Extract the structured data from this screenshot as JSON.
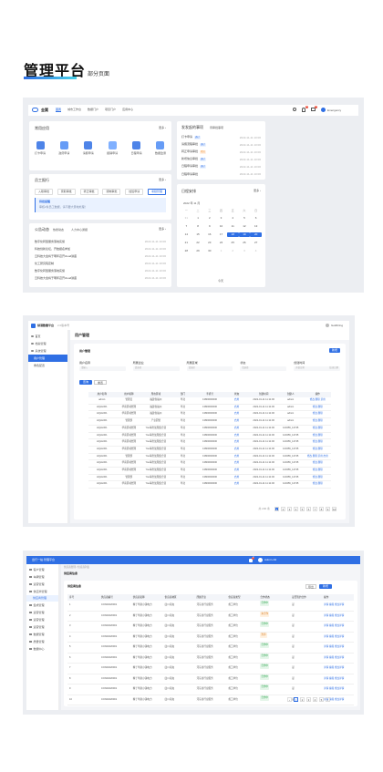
{
  "header": {
    "title": "管理平台",
    "subtitle": "部分页面"
  },
  "s1": {
    "logo": "金翼",
    "nav": [
      "首页",
      "城市工作台",
      "数据门户",
      "项目门户",
      "应用中心"
    ],
    "user": "Emergency",
    "badge1": "2",
    "badge2": "1",
    "common": {
      "title": "常用应用",
      "more": "更多 ›",
      "apps": [
        "打卡申请",
        "政府申请",
        "请假申请",
        "报销申请",
        "日程申请",
        "数据监测"
      ]
    },
    "todo": {
      "title": "员工报行",
      "more": "更多 ›",
      "tabs": [
        "入职审批",
        "离职审批",
        "转正审批",
        "调岗审批",
        "加班申请",
        "考勤管理"
      ],
      "banner_title": "待批提醒",
      "banner_text": "审核2条员工数据，请不要大意地处理！"
    },
    "notice": {
      "title": "公告动态",
      "tab2": "热搜动态",
      "tab3": "人力中心通报",
      "more": "更多 ›",
      "items": [
        {
          "t": "数字化转型服务落地实施",
          "d": "2022-11-11 10:00"
        },
        {
          "t": "科技创新论坛，开始报名参加",
          "d": "2022-11-11 10:00"
        },
        {
          "t": "云科技大会将于明年召开cloud讲座",
          "d": "2022-11-11 10:00"
        },
        {
          "t": "化工研究院定制",
          "d": "2022-11-11 10:00"
        },
        {
          "t": "数字化转型服务落地实施",
          "d": "2022-11-11 10:00"
        },
        {
          "t": "云科技大会将于明年召开cloud讲座",
          "d": "2022-11-11 10:00"
        }
      ]
    },
    "approval": {
      "title": "发发起的事项",
      "tab2": "待审批事项",
      "items": [
        {
          "t": "打卡申请",
          "tag": "通过",
          "d": "2022-11-11 10:00"
        },
        {
          "t": "请假流程审批",
          "tag": "通过",
          "d": "2022-11-11 10:00"
        },
        {
          "t": "转正申请审批",
          "tag": "驳回",
          "d": "2022-11-11 10:00"
        },
        {
          "t": "新增信息审批",
          "tag": "通过",
          "d": "2022-11-11 10:00"
        },
        {
          "t": "日程申请审批",
          "tag": "通过",
          "d": "2022-11-11 10:00"
        },
        {
          "t": "日程申请审批",
          "tag": "",
          "d": "2022-11-11 10:00"
        }
      ]
    },
    "calendar": {
      "title": "日程安排",
      "more": "更多 ›",
      "month": "2022 年 11 月",
      "week": [
        "一",
        "二",
        "三",
        "四",
        "五",
        "六",
        "日"
      ],
      "days": [
        31,
        1,
        2,
        3,
        4,
        5,
        6,
        7,
        8,
        9,
        10,
        11,
        12,
        13,
        14,
        15,
        16,
        17,
        18,
        19,
        20,
        21,
        22,
        23,
        24,
        25,
        26,
        27,
        28,
        29,
        30,
        1,
        2,
        3,
        4
      ],
      "highlight": [
        18,
        19,
        20
      ],
      "footer": "今天"
    }
  },
  "s2": {
    "logo": "绿港数管平台",
    "tag": "2.0版本号",
    "user": "Goldbring",
    "sidebar": [
      "首页",
      "档案管理",
      "系统管理",
      "用户管理",
      "角色配置"
    ],
    "page_title": "用户管理",
    "card_title": "用户管理",
    "new_btn": "新增",
    "filters": [
      {
        "l": "用户名称",
        "p": "请输入"
      },
      {
        "l": "所属企业",
        "p": "请选择"
      },
      {
        "l": "所属区域",
        "p": "请选择"
      },
      {
        "l": "状态",
        "p": "请选择"
      },
      {
        "l": "创建时间",
        "p": "开始日期"
      }
    ],
    "date_end": "结束日期",
    "search": "查询",
    "reset": "重置",
    "cols": [
      "用户名称",
      "用户昵称",
      "所在区域",
      "部门",
      "手机号",
      "状态",
      "创建时间",
      "创建人",
      "操作"
    ],
    "rows": [
      [
        "admin",
        "管理员",
        "福建省福州",
        "华北",
        "13800000000",
        "启用",
        "2022-01-11 11:11:00",
        "admin",
        "修改 删除 禁用"
      ],
      [
        "HQHL001",
        "华南区域经理",
        "福建省福州",
        "华北",
        "13800000000",
        "启用",
        "2022-01-11 11:11:00",
        "admin",
        "修改 删除"
      ],
      [
        "HQHL001",
        "华南区域经理",
        "福建省福州",
        "华北",
        "13800000000",
        "启用",
        "2022-01-11 11:11:00",
        "admin",
        "修改 删除"
      ],
      [
        "HQHL001",
        "管理部",
        "产业园管",
        "华北",
        "13800000000",
        "启用",
        "2022-01-11 11:11:00",
        "admin",
        "修改 删除"
      ],
      [
        "HQHL001",
        "华南区域经理",
        "Yoo事务处理组合营",
        "华北",
        "13800000000",
        "启用",
        "2022-01-11 11:11:00",
        "123456_12745",
        "修改 删除"
      ],
      [
        "HQHL001",
        "华南区域经理",
        "Yoo事务处理组合营",
        "华北",
        "13800000000",
        "启用",
        "2022-01-11 11:11:00",
        "123456_12745",
        "修改 删除"
      ],
      [
        "HQHL001",
        "华南区域经理",
        "Yoo事务处理组合营",
        "华北",
        "13800000000",
        "启用",
        "2022-01-11 11:11:00",
        "123456_12745",
        "修改 删除"
      ],
      [
        "HQHL001",
        "华南区域经理",
        "Yoo事务处理组合营",
        "华北",
        "13800000000",
        "启用",
        "2022-01-11 11:11:00",
        "123456_12745",
        "修改 删除"
      ],
      [
        "HQHL001",
        "管理部",
        "Yoo事务处理组合营",
        "华北",
        "13800000000",
        "启用",
        "2022-01-11 11:11:00",
        "123456_12745",
        "修改 删除 禁用 启用"
      ],
      [
        "HQHL001",
        "华南区域经理",
        "Yoo事务处理组合营",
        "华北",
        "13800000000",
        "启用",
        "2022-01-11 11:11:00",
        "123456_12745",
        "修改 删除"
      ],
      [
        "HQHL001",
        "华南区域经理",
        "Yoo事务处理组合营",
        "华北",
        "13800000000",
        "启用",
        "2022-01-11 11:11:00",
        "123456_12745",
        "修改 删除"
      ],
      [
        "HQHL001",
        "管理部",
        "Yoo事务处理组合营",
        "华北",
        "13800000000",
        "启用",
        "2022-01-11 11:11:00",
        "123456_12745",
        "修改 删除"
      ],
      [
        "HQHL001",
        "华南区域经理",
        "Yoo事务处理组合营",
        "华北",
        "13800000000",
        "启用",
        "2022-01-11 11:11:00",
        "123456_12745",
        "修改 删除"
      ]
    ],
    "pager": {
      "total": "共 200 条",
      "pages": [
        "1",
        "2",
        "3",
        "4",
        "5",
        "6",
        "7",
        "8",
        "9",
        "10"
      ]
    }
  },
  "s3": {
    "logo": "出行一站·管理平台",
    "user": "Admin·A6",
    "badge": "2",
    "sidebar": [
      "客户管理",
      "车辆管理",
      "运营管理",
      "供应商管理",
      "集成管理",
      "运营管理",
      "运营管理",
      "运营管理",
      "数据管理",
      "质量管理",
      "数据中心"
    ],
    "active": "供应商管理",
    "breadcrumb": "供应商管理 / 供应商列表",
    "page_title": "供应商信息",
    "card_title": "供应商信息",
    "export": "导出",
    "add": "新增",
    "cols": [
      "序号",
      "供应商编号",
      "供应商名称",
      "供应商地区",
      "所属行业",
      "供应商类型",
      "合作状态",
      "是否签约合作",
      "操作"
    ],
    "rows": [
      [
        "1",
        "CON20220001",
        "精于华航小镇电力",
        "四川南充",
        "河东省行业服务",
        "施工单位",
        "合作中",
        "是",
        "详情 编辑 修改详情"
      ],
      [
        "2",
        "CON20220001",
        "精于华航小镇电力",
        "四川南充",
        "河东省行业服务",
        "施工单位",
        "未合作",
        "是",
        "详情 编辑 修改详情"
      ],
      [
        "3",
        "CON20220001",
        "精于华航小镇电力",
        "四川南充",
        "河东省行业服务",
        "施工单位",
        "合作中",
        "是",
        "详情 编辑 修改详情"
      ],
      [
        "4",
        "CON20220001",
        "精于华航小镇电力",
        "四川南充",
        "河东省行业服务",
        "施工单位",
        "暂停",
        "是",
        "详情 编辑 修改详情"
      ],
      [
        "5",
        "CON20220001",
        "精于华航小镇电力",
        "四川南充",
        "河东省行业服务",
        "施工单位",
        "合作中",
        "是",
        "详情 编辑 修改详情"
      ],
      [
        "6",
        "CON20220001",
        "精于华航小镇电力",
        "四川南充",
        "河东省行业服务",
        "施工单位",
        "合作中",
        "是",
        "详情 编辑 修改详情"
      ],
      [
        "7",
        "CON20220001",
        "精于华航小镇电力",
        "四川南充",
        "河东省行业服务",
        "施工单位",
        "合作中",
        "是",
        "详情 编辑 修改详情"
      ],
      [
        "8",
        "CON20220001",
        "精于华航小镇电力",
        "四川南充",
        "河东省行业服务",
        "施工单位",
        "合作中",
        "是",
        "详情 编辑 修改详情"
      ],
      [
        "9",
        "CON20220001",
        "精于华航小镇电力",
        "四川南充",
        "河东省行业服务",
        "施工单位",
        "合作中",
        "是",
        "详情 编辑 修改详情"
      ],
      [
        "10",
        "CON20220001",
        "精于华航小镇电力",
        "四川南充",
        "河东省行业服务",
        "施工单位",
        "合作中",
        "是",
        "详情 编辑 修改详情"
      ]
    ],
    "pager": [
      "‹",
      "1",
      "2",
      "3",
      "4",
      "5",
      "›"
    ]
  }
}
